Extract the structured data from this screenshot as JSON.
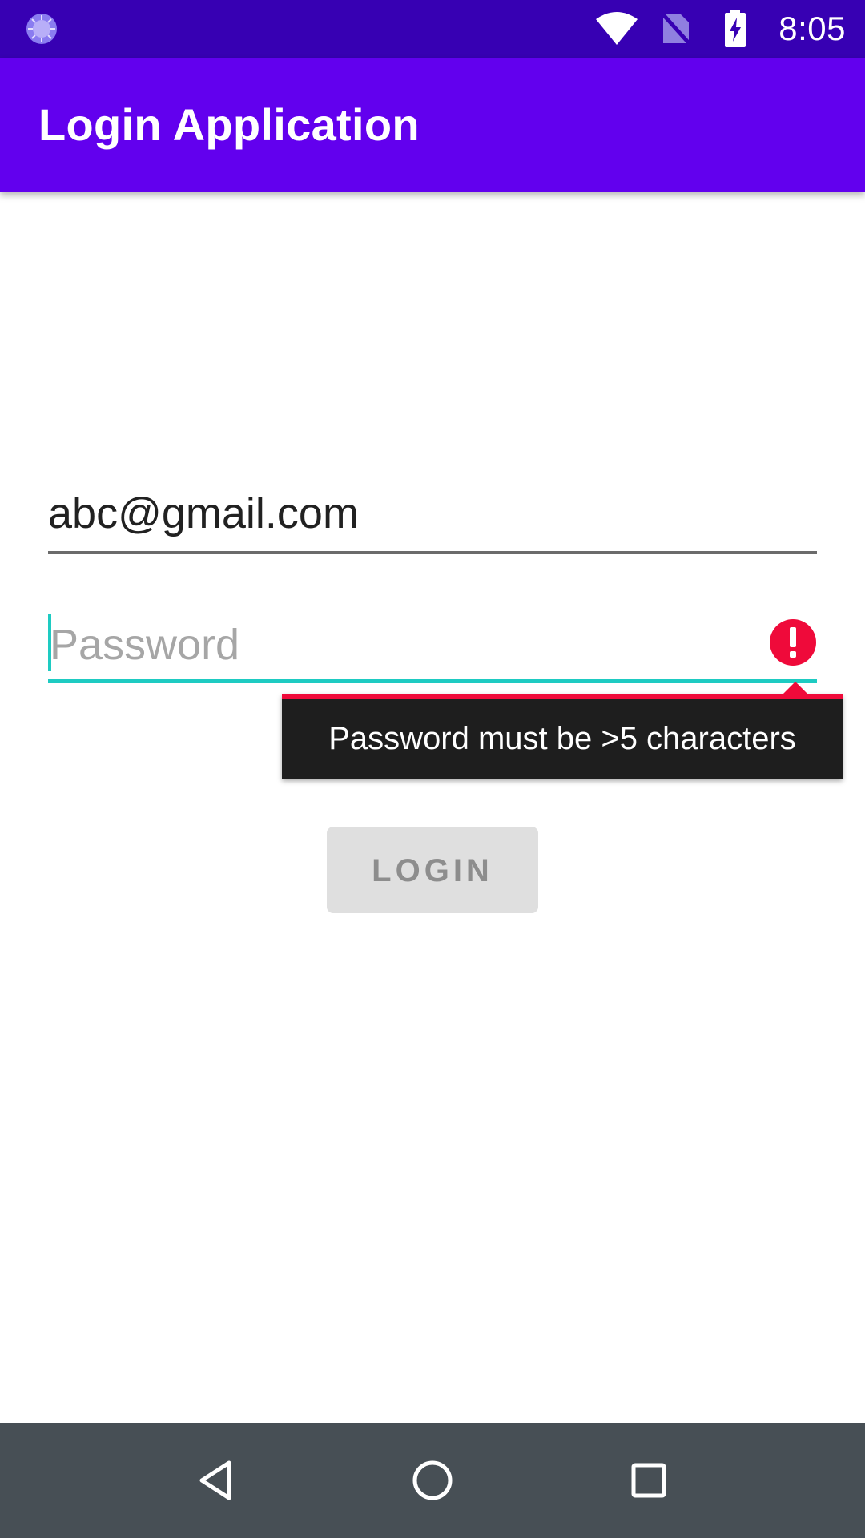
{
  "status_bar": {
    "time": "8:05",
    "icons": [
      "app-loading-icon",
      "wifi-icon",
      "no-sim-icon",
      "battery-charging-icon"
    ],
    "background": "#3700b3"
  },
  "app_bar": {
    "title": "Login Application",
    "background": "#6200ee"
  },
  "form": {
    "email": {
      "value": "abc@gmail.com"
    },
    "password": {
      "value": "",
      "placeholder": "Password",
      "error_icon": "error-icon",
      "accent_color": "#1ecbc2"
    },
    "error_tooltip": {
      "message": "Password must be >5 characters",
      "color": "#ef0a3a"
    },
    "login_button": {
      "label": "LOGIN",
      "enabled": false
    }
  },
  "nav_bar": {
    "buttons": [
      "back-icon",
      "home-icon",
      "recents-icon"
    ]
  }
}
